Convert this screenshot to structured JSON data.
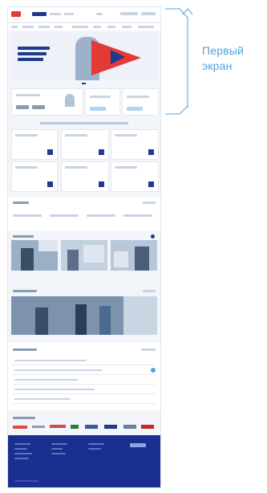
{
  "annotation": {
    "label_line1": "Первый",
    "label_line2": "экран",
    "bracket_color": "#4fa3e0"
  },
  "colors": {
    "accent_red": "#e53935",
    "accent_blue": "#1e3a8a",
    "footer_bg": "#1a2f8f",
    "page_bg": "#f2f5f9"
  },
  "icons": [
    "logo-icon",
    "arrow-logo-icon",
    "card-icon",
    "chevron-right-icon"
  ]
}
